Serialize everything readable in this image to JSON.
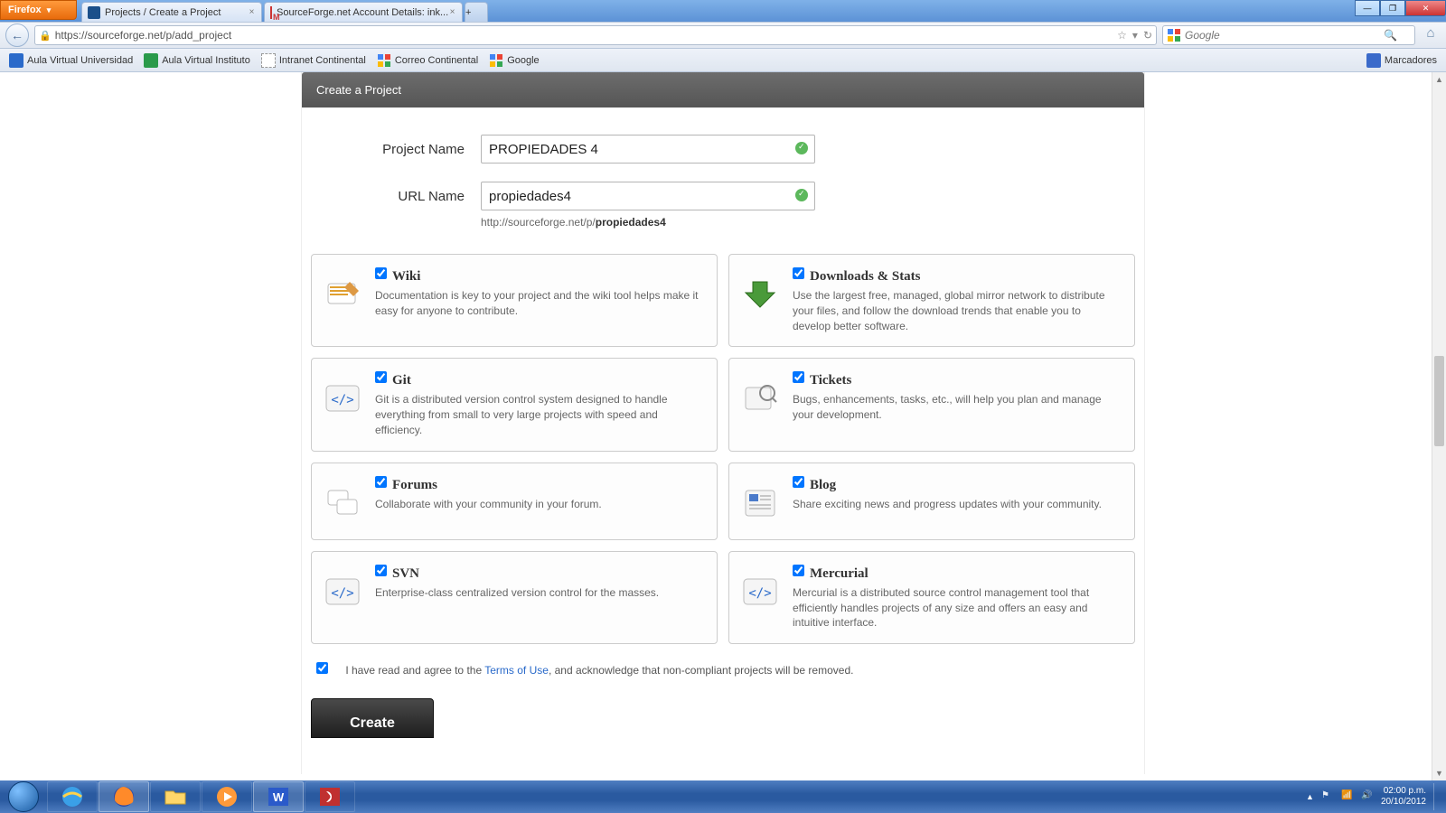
{
  "browser": {
    "name": "Firefox",
    "tabs": [
      {
        "title": "Projects / Create a Project",
        "favicon": "sf"
      },
      {
        "title": "SourceForge.net Account Details: ink...",
        "favicon": "gmail"
      }
    ],
    "url": "https://sourceforge.net/p/add_project",
    "search_placeholder": "Google",
    "bookmarks": [
      "Aula Virtual Universidad",
      "Aula Virtual Instituto",
      "Intranet Continental",
      "Correo Continental",
      "Google"
    ],
    "marcadores_label": "Marcadores"
  },
  "page": {
    "panel_title": "Create a Project",
    "labels": {
      "project_name": "Project Name",
      "url_name": "URL Name"
    },
    "values": {
      "project_name": "PROPIEDADES 4",
      "url_name": "propiedades4"
    },
    "url_preview_prefix": "http://sourceforge.net/p/",
    "url_preview_slug": "propiedades4",
    "features": [
      {
        "key": "wiki",
        "title": "Wiki",
        "desc": "Documentation is key to your project and the wiki tool helps make it easy for anyone to contribute.",
        "checked": true
      },
      {
        "key": "downloads",
        "title": "Downloads & Stats",
        "desc": "Use the largest free, managed, global mirror network to distribute your files, and follow the download trends that enable you to develop better software.",
        "checked": true
      },
      {
        "key": "git",
        "title": "Git",
        "desc": "Git is a distributed version control system designed to handle everything from small to very large projects with speed and efficiency.",
        "checked": true
      },
      {
        "key": "tickets",
        "title": "Tickets",
        "desc": "Bugs, enhancements, tasks, etc., will help you plan and manage your development.",
        "checked": true
      },
      {
        "key": "forums",
        "title": "Forums",
        "desc": "Collaborate with your community in your forum.",
        "checked": true
      },
      {
        "key": "blog",
        "title": "Blog",
        "desc": "Share exciting news and progress updates with your community.",
        "checked": true
      },
      {
        "key": "svn",
        "title": "SVN",
        "desc": "Enterprise-class centralized version control for the masses.",
        "checked": true
      },
      {
        "key": "mercurial",
        "title": "Mercurial",
        "desc": "Mercurial is a distributed source control management tool that efficiently handles projects of any size and offers an easy and intuitive interface.",
        "checked": true
      }
    ],
    "terms_prefix": "I have read and agree to the ",
    "terms_link": "Terms of Use",
    "terms_suffix": ", and acknowledge that non-compliant projects will be removed.",
    "terms_checked": true,
    "create_label": "Create"
  },
  "taskbar": {
    "time": "02:00 p.m.",
    "date": "20/10/2012"
  }
}
